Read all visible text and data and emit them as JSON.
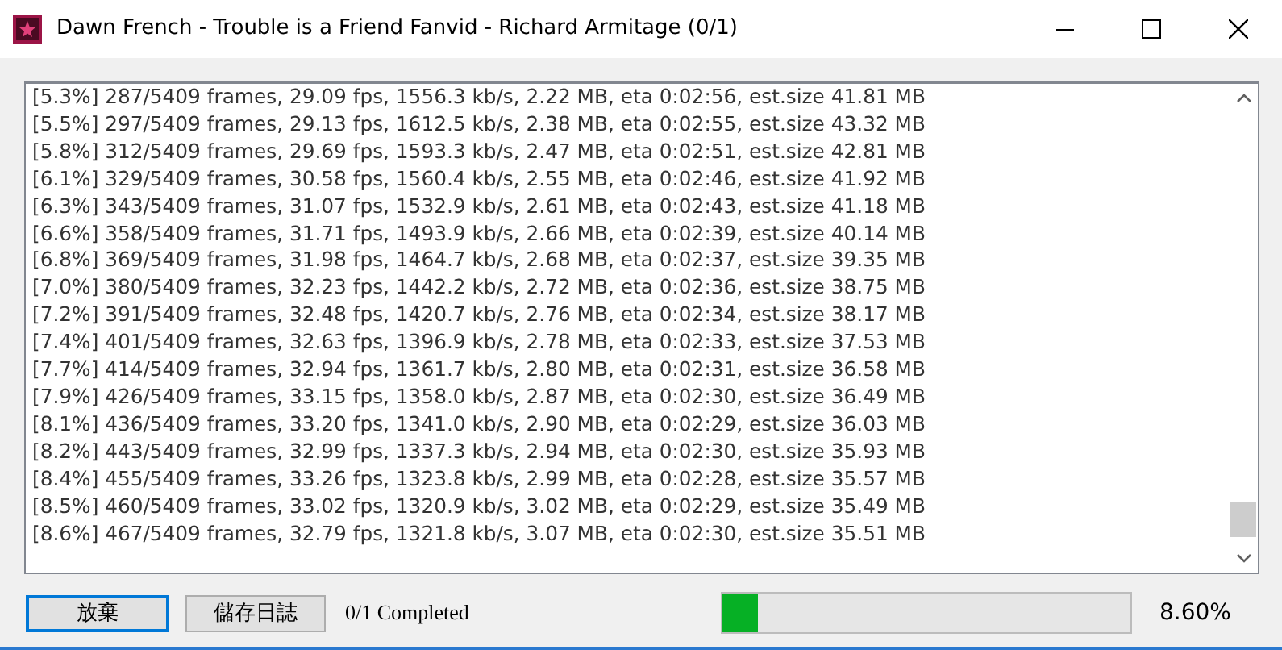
{
  "window": {
    "title": "Dawn French - Trouble is a Friend Fanvid - Richard Armitage (0/1)"
  },
  "log": {
    "lines": [
      "[5.3%] 287/5409 frames, 29.09 fps, 1556.3 kb/s, 2.22 MB, eta 0:02:56, est.size 41.81 MB",
      "[5.5%] 297/5409 frames, 29.13 fps, 1612.5 kb/s, 2.38 MB, eta 0:02:55, est.size 43.32 MB",
      "[5.8%] 312/5409 frames, 29.69 fps, 1593.3 kb/s, 2.47 MB, eta 0:02:51, est.size 42.81 MB",
      "[6.1%] 329/5409 frames, 30.58 fps, 1560.4 kb/s, 2.55 MB, eta 0:02:46, est.size 41.92 MB",
      "[6.3%] 343/5409 frames, 31.07 fps, 1532.9 kb/s, 2.61 MB, eta 0:02:43, est.size 41.18 MB",
      "[6.6%] 358/5409 frames, 31.71 fps, 1493.9 kb/s, 2.66 MB, eta 0:02:39, est.size 40.14 MB",
      "[6.8%] 369/5409 frames, 31.98 fps, 1464.7 kb/s, 2.68 MB, eta 0:02:37, est.size 39.35 MB",
      "[7.0%] 380/5409 frames, 32.23 fps, 1442.2 kb/s, 2.72 MB, eta 0:02:36, est.size 38.75 MB",
      "[7.2%] 391/5409 frames, 32.48 fps, 1420.7 kb/s, 2.76 MB, eta 0:02:34, est.size 38.17 MB",
      "[7.4%] 401/5409 frames, 32.63 fps, 1396.9 kb/s, 2.78 MB, eta 0:02:33, est.size 37.53 MB",
      "[7.7%] 414/5409 frames, 32.94 fps, 1361.7 kb/s, 2.80 MB, eta 0:02:31, est.size 36.58 MB",
      "[7.9%] 426/5409 frames, 33.15 fps, 1358.0 kb/s, 2.87 MB, eta 0:02:30, est.size 36.49 MB",
      "[8.1%] 436/5409 frames, 33.20 fps, 1341.0 kb/s, 2.90 MB, eta 0:02:29, est.size 36.03 MB",
      "[8.2%] 443/5409 frames, 32.99 fps, 1337.3 kb/s, 2.94 MB, eta 0:02:30, est.size 35.93 MB",
      "[8.4%] 455/5409 frames, 33.26 fps, 1323.8 kb/s, 2.99 MB, eta 0:02:28, est.size 35.57 MB",
      "[8.5%] 460/5409 frames, 33.02 fps, 1320.9 kb/s, 3.02 MB, eta 0:02:29, est.size 35.49 MB",
      "[8.6%] 467/5409 frames, 32.79 fps, 1321.8 kb/s, 3.07 MB, eta 0:02:30, est.size 35.51 MB"
    ]
  },
  "buttons": [
    {
      "label": "放棄",
      "focused": true
    },
    {
      "label": "儲存日誌",
      "focused": false
    }
  ],
  "status": "0/1 Completed",
  "progress": {
    "level": 0.086,
    "reading": "8.60%"
  }
}
